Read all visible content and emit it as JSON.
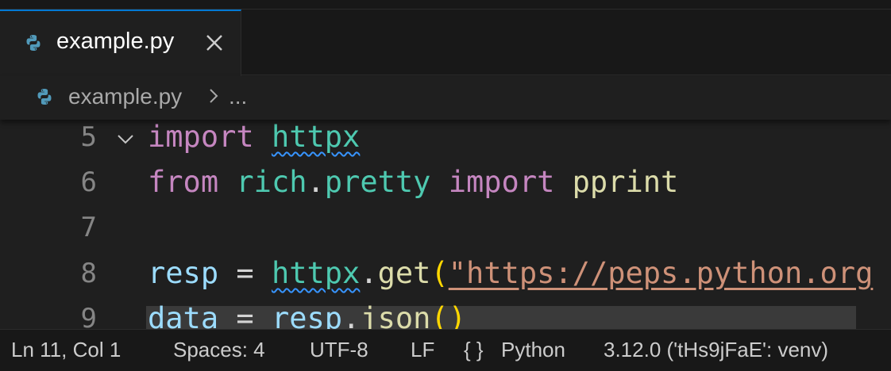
{
  "tab": {
    "label": "example.py",
    "icon": "python-icon"
  },
  "breadcrumb": {
    "file": "example.py",
    "more": "..."
  },
  "editor": {
    "lines": [
      {
        "number": "5"
      },
      {
        "number": "6"
      },
      {
        "number": "7"
      },
      {
        "number": "8"
      },
      {
        "number": "9"
      }
    ],
    "code": {
      "l5": {
        "kw": "import",
        "mod": "httpx"
      },
      "l6": {
        "kw1": "from",
        "mod": "rich",
        "dot": ".",
        "mod2": "pretty",
        "kw2": "import",
        "fn": "pprint"
      },
      "l8": {
        "var": "resp",
        "eq": "=",
        "mod": "httpx",
        "dot": ".",
        "fn": "get",
        "paren": "(",
        "str": "\"https://peps.python.org"
      },
      "l9": {
        "var": "data",
        "eq": "=",
        "var2": "resp",
        "dot": ".",
        "fn": "json",
        "paren": "()"
      }
    }
  },
  "statusbar": {
    "position": "Ln 11, Col 1",
    "spaces": "Spaces: 4",
    "encoding": "UTF-8",
    "eol": "LF",
    "lang_icon": "{ }",
    "language": "Python",
    "interpreter": "3.12.0 ('tHs9jFaE': venv)"
  },
  "colors": {
    "keyword": "#c586c0",
    "module": "#4ec9b0",
    "function": "#dcdcaa",
    "variable": "#9cdcfe",
    "string": "#ce9178",
    "accent": "#0078d4"
  }
}
